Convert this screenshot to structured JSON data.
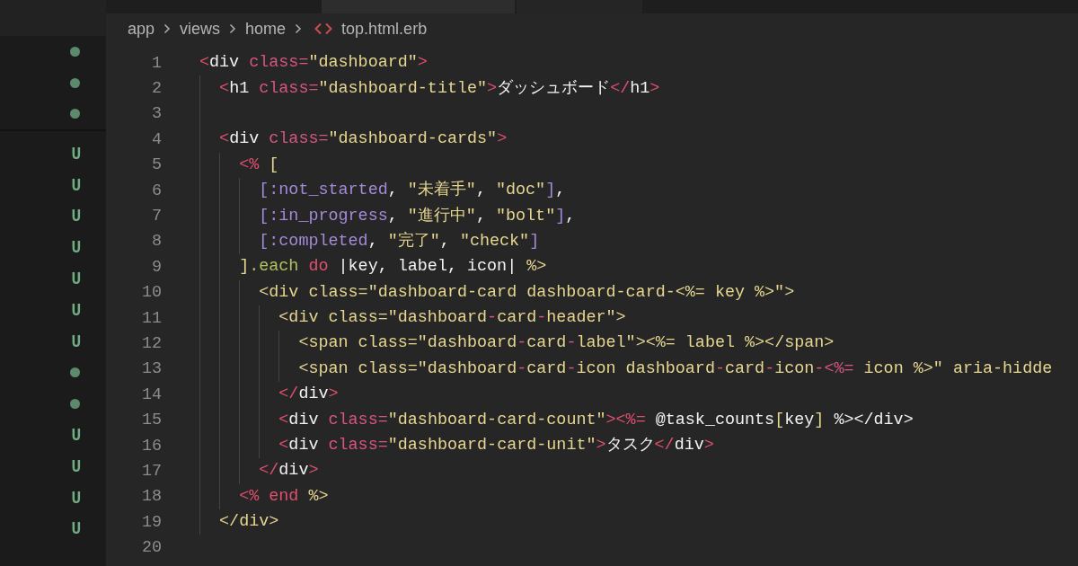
{
  "sidebar": {
    "sections": [
      {
        "items": [
          {
            "kind": "modified"
          },
          {
            "kind": "modified"
          },
          {
            "kind": "modified"
          }
        ]
      },
      {
        "items": [
          {
            "kind": "untracked",
            "badge": "U"
          },
          {
            "kind": "untracked",
            "badge": "U"
          },
          {
            "kind": "untracked",
            "badge": "U"
          },
          {
            "kind": "untracked",
            "badge": "U"
          },
          {
            "kind": "untracked",
            "badge": "U"
          },
          {
            "kind": "untracked",
            "badge": "U"
          },
          {
            "kind": "untracked",
            "badge": "U"
          },
          {
            "kind": "modified"
          },
          {
            "kind": "modified"
          },
          {
            "kind": "untracked",
            "badge": "U"
          },
          {
            "kind": "untracked",
            "badge": "U"
          },
          {
            "kind": "untracked",
            "badge": "U"
          },
          {
            "kind": "untracked",
            "badge": "U"
          }
        ]
      }
    ]
  },
  "breadcrumb": {
    "folders": [
      "app",
      "views",
      "home"
    ],
    "file": "top.html.erb"
  },
  "editor": {
    "lines": [
      {
        "number": "1",
        "tokens": [
          {
            "kind": "punct",
            "text": "<"
          },
          {
            "kind": "name",
            "text": "div "
          },
          {
            "kind": "attr",
            "text": "class="
          },
          {
            "kind": "str",
            "text": "\"dashboard\""
          },
          {
            "kind": "punct",
            "text": ">"
          }
        ],
        "children": [
          {
            "number": "2",
            "tokens": [
              {
                "kind": "punct",
                "text": "<"
              },
              {
                "kind": "name",
                "text": "h1 "
              },
              {
                "kind": "attr",
                "text": "class="
              },
              {
                "kind": "str",
                "text": "\"dashboard-title\""
              },
              {
                "kind": "punct",
                "text": ">"
              },
              {
                "kind": "plain",
                "text": "ダッシュボード"
              },
              {
                "kind": "punct",
                "text": "</"
              },
              {
                "kind": "name",
                "text": "h1"
              },
              {
                "kind": "punct",
                "text": ">"
              }
            ]
          },
          {
            "number": "3"
          },
          {
            "number": "4",
            "tokens": [
              {
                "kind": "punct",
                "text": "<"
              },
              {
                "kind": "name",
                "text": "div "
              },
              {
                "kind": "attr",
                "text": "class="
              },
              {
                "kind": "str",
                "text": "\"dashboard-cards\""
              },
              {
                "kind": "punct",
                "text": ">"
              }
            ],
            "children": [
              {
                "number": "5",
                "tokens": [
                  {
                    "kind": "punct",
                    "text": "<% "
                  },
                  {
                    "kind": "str",
                    "text": "["
                  }
                ],
                "children": [
                  {
                    "number": "6",
                    "tokens": [
                      {
                        "kind": "sym",
                        "text": "[:not_started"
                      },
                      {
                        "kind": "plain",
                        "text": ", "
                      },
                      {
                        "kind": "str",
                        "text": "\"未着手\""
                      },
                      {
                        "kind": "plain",
                        "text": ", "
                      },
                      {
                        "kind": "str",
                        "text": "\"doc\""
                      },
                      {
                        "kind": "sym",
                        "text": "]"
                      },
                      {
                        "kind": "plain",
                        "text": ","
                      }
                    ]
                  },
                  {
                    "number": "7",
                    "tokens": [
                      {
                        "kind": "sym",
                        "text": "[:in_progress"
                      },
                      {
                        "kind": "plain",
                        "text": ", "
                      },
                      {
                        "kind": "str",
                        "text": "\"進行中\""
                      },
                      {
                        "kind": "plain",
                        "text": ", "
                      },
                      {
                        "kind": "str",
                        "text": "\"bolt\""
                      },
                      {
                        "kind": "sym",
                        "text": "]"
                      },
                      {
                        "kind": "plain",
                        "text": ","
                      }
                    ]
                  },
                  {
                    "number": "8",
                    "tokens": [
                      {
                        "kind": "sym",
                        "text": "[:completed"
                      },
                      {
                        "kind": "plain",
                        "text": ", "
                      },
                      {
                        "kind": "str",
                        "text": "\"完了\""
                      },
                      {
                        "kind": "plain",
                        "text": ", "
                      },
                      {
                        "kind": "str",
                        "text": "\"check\""
                      },
                      {
                        "kind": "sym",
                        "text": "]"
                      }
                    ]
                  }
                ]
              },
              {
                "number": "9",
                "tokens": [
                  {
                    "kind": "str",
                    "text": "]"
                  },
                  {
                    "kind": "method",
                    "text": ".each "
                  },
                  {
                    "kind": "kw",
                    "text": "do "
                  },
                  {
                    "kind": "plain",
                    "text": "|key, label, icon| "
                  },
                  {
                    "kind": "str",
                    "text": "%>"
                  }
                ],
                "children": [
                  {
                    "number": "10",
                    "tokens": [
                      {
                        "kind": "str",
                        "text": "<div class=\"dashboard-card dashboard-card-<%= key %>\">"
                      }
                    ],
                    "children": [
                      {
                        "number": "11",
                        "tokens": [
                          {
                            "kind": "str",
                            "text": "<div class=\"dashboard"
                          },
                          {
                            "kind": "attr",
                            "text": "-"
                          },
                          {
                            "kind": "str",
                            "text": "card"
                          },
                          {
                            "kind": "attr",
                            "text": "-"
                          },
                          {
                            "kind": "str",
                            "text": "header\">"
                          }
                        ],
                        "children": [
                          {
                            "number": "12",
                            "tokens": [
                              {
                                "kind": "str",
                                "text": "<span class=\"dashboard"
                              },
                              {
                                "kind": "attr",
                                "text": "-"
                              },
                              {
                                "kind": "str",
                                "text": "card"
                              },
                              {
                                "kind": "attr",
                                "text": "-"
                              },
                              {
                                "kind": "str",
                                "text": "label\"><%= label %></span>"
                              }
                            ]
                          },
                          {
                            "number": "13",
                            "tokens": [
                              {
                                "kind": "str",
                                "text": "<span class=\"dashboard"
                              },
                              {
                                "kind": "attr",
                                "text": "-"
                              },
                              {
                                "kind": "str",
                                "text": "card"
                              },
                              {
                                "kind": "attr",
                                "text": "-"
                              },
                              {
                                "kind": "str",
                                "text": "icon dashboard"
                              },
                              {
                                "kind": "attr",
                                "text": "-"
                              },
                              {
                                "kind": "str",
                                "text": "card"
                              },
                              {
                                "kind": "attr",
                                "text": "-"
                              },
                              {
                                "kind": "str",
                                "text": "icon"
                              },
                              {
                                "kind": "attr",
                                "text": "-<%="
                              },
                              {
                                "kind": "str",
                                "text": " icon %>\" aria-hidde"
                              }
                            ]
                          }
                        ]
                      },
                      {
                        "number": "14",
                        "tokens": [
                          {
                            "kind": "punct",
                            "text": "</"
                          },
                          {
                            "kind": "name",
                            "text": "div"
                          },
                          {
                            "kind": "punct",
                            "text": ">"
                          }
                        ]
                      },
                      {
                        "number": "15",
                        "tokens": [
                          {
                            "kind": "punct",
                            "text": "<"
                          },
                          {
                            "kind": "name",
                            "text": "div "
                          },
                          {
                            "kind": "attr",
                            "text": "class="
                          },
                          {
                            "kind": "str",
                            "text": "\"dashboard-card-count\""
                          },
                          {
                            "kind": "punct",
                            "text": "><%= "
                          },
                          {
                            "kind": "plain",
                            "text": "@task_counts"
                          },
                          {
                            "kind": "str",
                            "text": "["
                          },
                          {
                            "kind": "plain",
                            "text": "key"
                          },
                          {
                            "kind": "str",
                            "text": "] "
                          },
                          {
                            "kind": "plain",
                            "text": "%></div>"
                          }
                        ]
                      },
                      {
                        "number": "16",
                        "tokens": [
                          {
                            "kind": "punct",
                            "text": "<"
                          },
                          {
                            "kind": "name",
                            "text": "div "
                          },
                          {
                            "kind": "attr",
                            "text": "class="
                          },
                          {
                            "kind": "str",
                            "text": "\"dashboard-card-unit\""
                          },
                          {
                            "kind": "punct",
                            "text": ">"
                          },
                          {
                            "kind": "plain",
                            "text": "タスク"
                          },
                          {
                            "kind": "punct",
                            "text": "</"
                          },
                          {
                            "kind": "name",
                            "text": "div"
                          },
                          {
                            "kind": "punct",
                            "text": ">"
                          }
                        ]
                      }
                    ]
                  },
                  {
                    "number": "17",
                    "tokens": [
                      {
                        "kind": "punct",
                        "text": "</"
                      },
                      {
                        "kind": "name",
                        "text": "div"
                      },
                      {
                        "kind": "punct",
                        "text": ">"
                      }
                    ]
                  }
                ]
              },
              {
                "number": "18",
                "tokens": [
                  {
                    "kind": "punct",
                    "text": "<% "
                  },
                  {
                    "kind": "kw",
                    "text": "end "
                  },
                  {
                    "kind": "str",
                    "text": "%>"
                  }
                ]
              }
            ]
          },
          {
            "number": "19",
            "tokens": [
              {
                "kind": "str",
                "text": "</div>"
              }
            ]
          }
        ]
      },
      {
        "number": "20"
      }
    ]
  }
}
